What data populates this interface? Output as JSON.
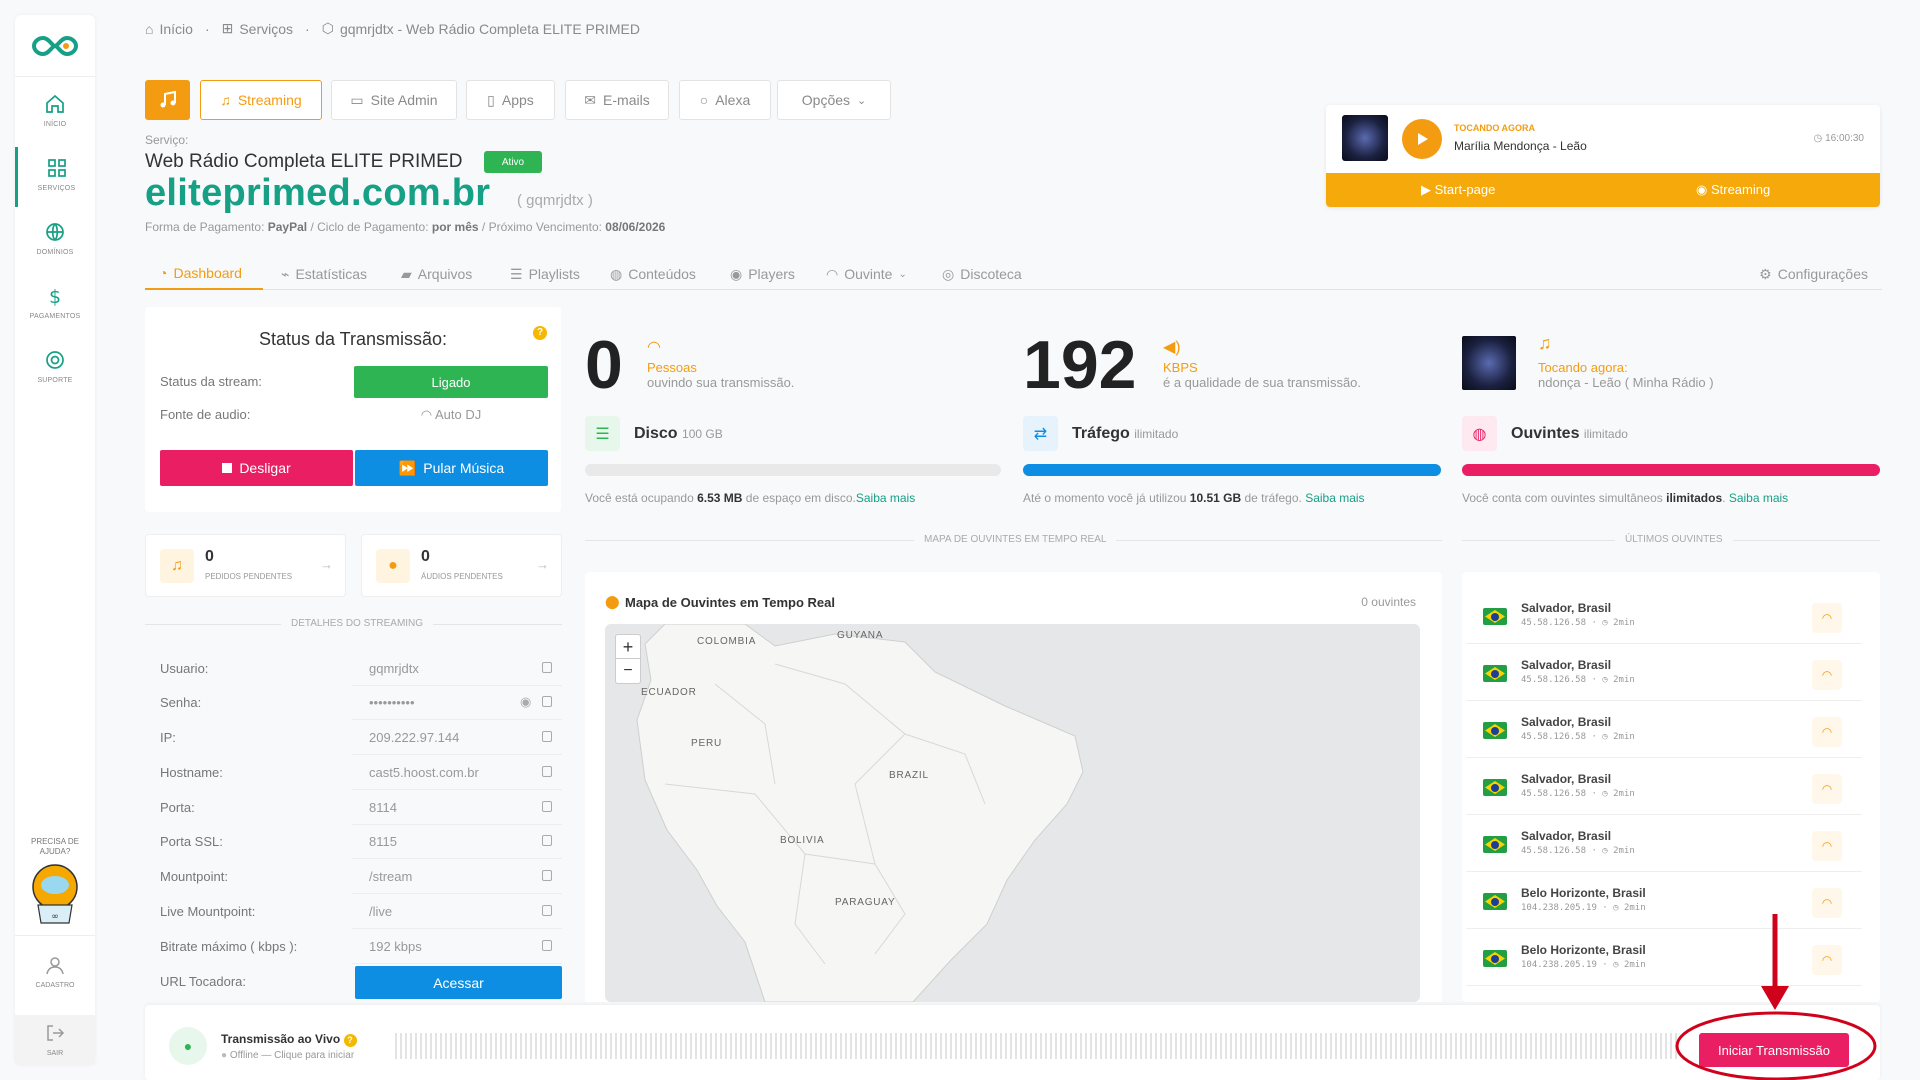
{
  "sidebar": {
    "items": [
      {
        "label": "INÍCIO"
      },
      {
        "label": "SERVIÇOS"
      },
      {
        "label": "DOMÍNIOS"
      },
      {
        "label": "PAGAMENTOS"
      },
      {
        "label": "SUPORTE"
      }
    ],
    "help": "PRECISA DE AJUDA?",
    "cadastro": "CADASTRO",
    "sair": "SAIR"
  },
  "breadcrumb": {
    "home": "Início",
    "services": "Serviços",
    "current": "gqmrjdtx - Web Rádio Completa ELITE PRIMED"
  },
  "toolbar": {
    "streaming": "Streaming",
    "site_admin": "Site Admin",
    "apps": "Apps",
    "emails": "E-mails",
    "alexa": "Alexa",
    "opcoes": "Opções"
  },
  "service": {
    "label": "Serviço:",
    "name": "Web Rádio Completa ELITE PRIMED",
    "status": "Ativo",
    "domain": "eliteprimed.com.br",
    "username": "( gqmrjdtx )",
    "payment_label": "Forma de Pagamento:",
    "payment": "PayPal",
    "cycle_label": " / Ciclo de Pagamento:",
    "cycle": "por mês",
    "due_label": " / Próximo Vencimento:",
    "due": "08/06/2026"
  },
  "player": {
    "now_label": "TOCANDO AGORA",
    "track": "Marília Mendonça - Leão",
    "time": "16:00:30",
    "start_page": "Start-page",
    "streaming": "Streaming"
  },
  "tabs": {
    "dashboard": "Dashboard",
    "estatisticas": "Estatísticas",
    "arquivos": "Arquivos",
    "playlists": "Playlists",
    "conteudos": "Conteúdos",
    "players": "Players",
    "ouvinte": "Ouvinte",
    "discoteca": "Discoteca",
    "config": "Configurações"
  },
  "status": {
    "title": "Status da Transmissão:",
    "stream_label": "Status da stream:",
    "stream_value": "Ligado",
    "audio_label": "Fonte de audio:",
    "audio_value": "Auto DJ",
    "off_btn": "Desligar",
    "skip_btn": "Pular Música"
  },
  "pending": {
    "requests_count": "0",
    "requests_label": "PEDIDOS PENDENTES",
    "audios_count": "0",
    "audios_label": "ÁUDIOS PENDENTES"
  },
  "details": {
    "section": "DETALHES DO STREAMING",
    "rows": [
      {
        "label": "Usuario:",
        "value": "gqmrjdtx"
      },
      {
        "label": "Senha:",
        "value": "••••••••••"
      },
      {
        "label": "IP:",
        "value": "209.222.97.144"
      },
      {
        "label": "Hostname:",
        "value": "cast5.hoost.com.br"
      },
      {
        "label": "Porta:",
        "value": "8114"
      },
      {
        "label": "Porta SSL:",
        "value": "8115"
      },
      {
        "label": "Mountpoint:",
        "value": "/stream"
      },
      {
        "label": "Live Mountpoint:",
        "value": "/live"
      },
      {
        "label": "Bitrate máximo ( kbps ):",
        "value": "192 kbps"
      }
    ],
    "url_label": "URL Tocadora:",
    "url_btn": "Acessar"
  },
  "stats": {
    "listeners": "0",
    "listeners_label": "Pessoas",
    "listeners_sub": "ouvindo sua transmissão.",
    "kbps": "192",
    "kbps_label": "KBPS",
    "kbps_sub": "é a qualidade de sua transmissão.",
    "now_label": "Tocando agora:",
    "now_track": "ndonça - Leão ( Minha Rádio )"
  },
  "usage": {
    "disk_title": "Disco",
    "disk_cap": "100 GB",
    "disk_text1": "Você está ocupando ",
    "disk_value": "6.53 MB",
    "disk_text2": " de espaço em disco.",
    "disk_link": "Saiba mais",
    "disk_pct": 0.01,
    "traffic_title": "Tráfego",
    "traffic_cap": "ilimitado",
    "traffic_text1": "Até o momento você já utilizou ",
    "traffic_value": "10.51 GB",
    "traffic_text2": " de tráfego. ",
    "traffic_link": "Saiba mais",
    "traffic_pct": 100,
    "ouv_title": "Ouvintes",
    "ouv_cap": "ilimitado",
    "ouv_text1": "Você conta com ouvintes simultâneos ",
    "ouv_value": "ilimitados",
    "ouv_text2": ". ",
    "ouv_link": "Saiba mais",
    "ouv_pct": 100
  },
  "map": {
    "section": "MAPA DE OUVINTES EM TEMPO REAL",
    "title": "Mapa de Ouvintes em Tempo Real",
    "count": "0 ouvintes",
    "labels": [
      "COLOMBIA",
      "GUYANA",
      "ECUADOR",
      "PERU",
      "BRAZIL",
      "BOLIVIA",
      "PARAGUAY"
    ],
    "zoom_in": "+",
    "zoom_out": "−"
  },
  "last": {
    "section": "ÚLTIMOS OUVINTES",
    "items": [
      {
        "city": "Salvador, Brasil",
        "ip": "45.58.126.58",
        "ago": "2min"
      },
      {
        "city": "Salvador, Brasil",
        "ip": "45.58.126.58",
        "ago": "2min"
      },
      {
        "city": "Salvador, Brasil",
        "ip": "45.58.126.58",
        "ago": "2min"
      },
      {
        "city": "Salvador, Brasil",
        "ip": "45.58.126.58",
        "ago": "2min"
      },
      {
        "city": "Salvador, Brasil",
        "ip": "45.58.126.58",
        "ago": "2min"
      },
      {
        "city": "Belo Horizonte, Brasil",
        "ip": "104.238.205.19",
        "ago": "2min"
      },
      {
        "city": "Belo Horizonte, Brasil",
        "ip": "104.238.205.19",
        "ago": "2min"
      }
    ]
  },
  "live": {
    "title": "Transmissão ao Vivo",
    "status": "Offline — Clique para iniciar",
    "button": "Iniciar Transmissão"
  },
  "colors": {
    "accent": "#f39c12",
    "green": "#16a085",
    "blue": "#0d8ee3",
    "pink": "#e91e63",
    "success": "#2fb454"
  }
}
